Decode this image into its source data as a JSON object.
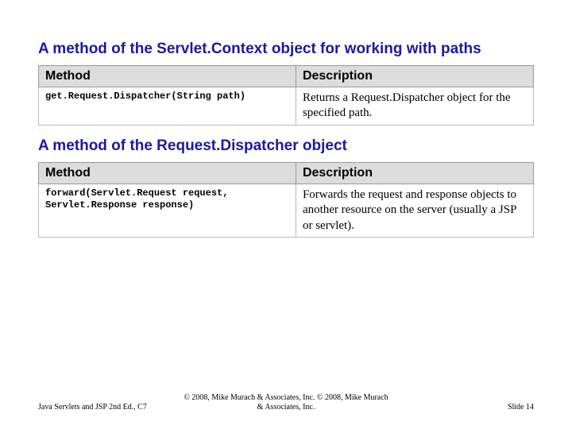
{
  "section1": {
    "heading": "A method of the Servlet.Context object for working with paths",
    "colMethod": "Method",
    "colDesc": "Description",
    "row": {
      "method": "get.Request.Dispatcher(String path)",
      "desc": "Returns a Request.Dispatcher object for the specified path."
    }
  },
  "section2": {
    "heading": "A method of the Request.Dispatcher object",
    "colMethod": "Method",
    "colDesc": "Description",
    "row": {
      "method": "forward(Servlet.Request request,\nServlet.Response response)",
      "desc": "Forwards the request and response objects to another resource on the server (usually a JSP or servlet)."
    }
  },
  "footer": {
    "left": "Java Servlets and JSP 2nd Ed., C7",
    "center": "© 2008, Mike Murach & Associates, Inc. © 2008, Mike Murach & Associates, Inc.",
    "right": "Slide 14"
  }
}
